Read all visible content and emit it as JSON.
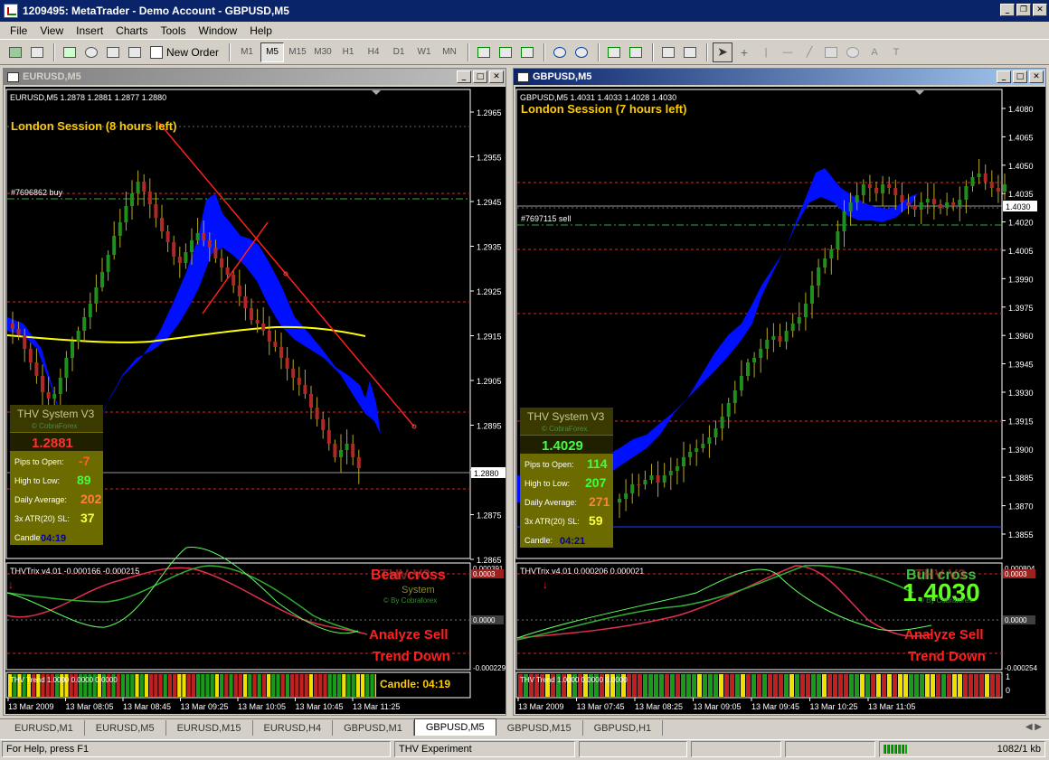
{
  "window": {
    "title": "1209495: MetaTrader - Demo Account - GBPUSD,M5"
  },
  "menu": [
    "File",
    "View",
    "Insert",
    "Charts",
    "Tools",
    "Window",
    "Help"
  ],
  "toolbar": {
    "new_order": "New Order",
    "timeframes": [
      "M1",
      "M5",
      "M15",
      "M30",
      "H1",
      "H4",
      "D1",
      "W1",
      "MN"
    ],
    "active_timeframe": "M5"
  },
  "left": {
    "window_title": "EURUSD,M5",
    "header": "EURUSD,M5  1.2878 1.2881 1.2877 1.2880",
    "session": "London Session (8 hours left)",
    "order_label": "#7696862 buy",
    "price_ticks": [
      "1.2965",
      "1.2955",
      "1.2945",
      "1.2935",
      "1.2925",
      "1.2915",
      "1.2905",
      "1.2895",
      "1.2885",
      "1.2875",
      "1.2865"
    ],
    "current_price": "1.2880",
    "panel": {
      "title": "THV System V3",
      "brand": "© CobraForex",
      "price": "1.2881",
      "pips_label": "Pips to Open:",
      "pips": "-7",
      "hl_label": "High to Low:",
      "hl": "89",
      "avg_label": "Daily Average:",
      "avg": "202",
      "atr_label": "3x ATR(20) SL:",
      "atr": "37",
      "candle_label": "Candle:",
      "candle": "04:19"
    },
    "trix_header": "THVTrix v4.01 -0.000166 -0.000215",
    "trix_ticks": [
      "0.000391",
      "0.0003",
      "0.0000",
      "-0.000229"
    ],
    "cross": "Bear cross",
    "cross_overlap": "THV V3",
    "system_label": "System",
    "by_label": "© By Cobraforex",
    "analyze": "Analyze Sell",
    "trend": "Trend Down",
    "trend_header": "THV Trend 1.0000 0.0000 0.0000",
    "trend_candle": "Candle:  04:19",
    "dates": [
      "13 Mar 2009",
      "13 Mar 08:05",
      "13 Mar 08:45",
      "13 Mar 09:25",
      "13 Mar 10:05",
      "13 Mar 10:45",
      "13 Mar 11:25"
    ]
  },
  "right": {
    "window_title": "GBPUSD,M5",
    "header": "GBPUSD,M5  1.4031 1.4033 1.4028 1.4030",
    "session": "London Session (7 hours left)",
    "order_label": "#7697115 sell",
    "price_ticks": [
      "1.4080",
      "1.4065",
      "1.4050",
      "1.4035",
      "1.4020",
      "1.4005",
      "1.3990",
      "1.3975",
      "1.3960",
      "1.3945",
      "1.3930",
      "1.3915",
      "1.3900",
      "1.3885",
      "1.3870",
      "1.3855"
    ],
    "current_price": "1.4030",
    "panel": {
      "title": "THV System V3",
      "brand": "© CobraForex",
      "price": "1.4029",
      "pips_label": "Pips to Open:",
      "pips": "114",
      "hl_label": "High to Low:",
      "hl": "207",
      "avg_label": "Daily Average:",
      "avg": "271",
      "atr_label": "3x ATR(20) SL:",
      "atr": "59",
      "candle_label": "Candle:",
      "candle": "04:21"
    },
    "trix_header": "THVTrix v4.01 0.000206 0.000021",
    "trix_ticks": [
      "0.000804",
      "0.0003",
      "0.0000",
      "-0.000254"
    ],
    "cross": "Bull cross",
    "cross_overlap": "THV V3",
    "big_price": "1.4030",
    "by_label": "© By Cobraforex",
    "analyze": "Analyze Sell",
    "trend": "Trend Down",
    "trend_header": "THV Trend 1.0000 0.0000 0.0000",
    "trend_ticks": [
      "1",
      "0"
    ],
    "dates": [
      "13 Mar 2009",
      "13 Mar 07:45",
      "13 Mar 08:25",
      "13 Mar 09:05",
      "13 Mar 09:45",
      "13 Mar 10:25",
      "13 Mar 11:05"
    ]
  },
  "tabs": [
    "EURUSD,M1",
    "EURUSD,M5",
    "EURUSD,M15",
    "EURUSD,H4",
    "GBPUSD,M1",
    "GBPUSD,M5",
    "GBPUSD,M15",
    "GBPUSD,H1"
  ],
  "active_tab": "GBPUSD,M5",
  "status": {
    "help": "For Help, press F1",
    "profile": "THV Experiment",
    "traffic": "1082/1 kb"
  },
  "colors": {
    "bull": "#1f8f1f",
    "bear": "#b02828",
    "cloud": "#0000ff",
    "ma": "#ffff00",
    "session": "#ffcc00",
    "panel_bg": "#6b6b00"
  }
}
